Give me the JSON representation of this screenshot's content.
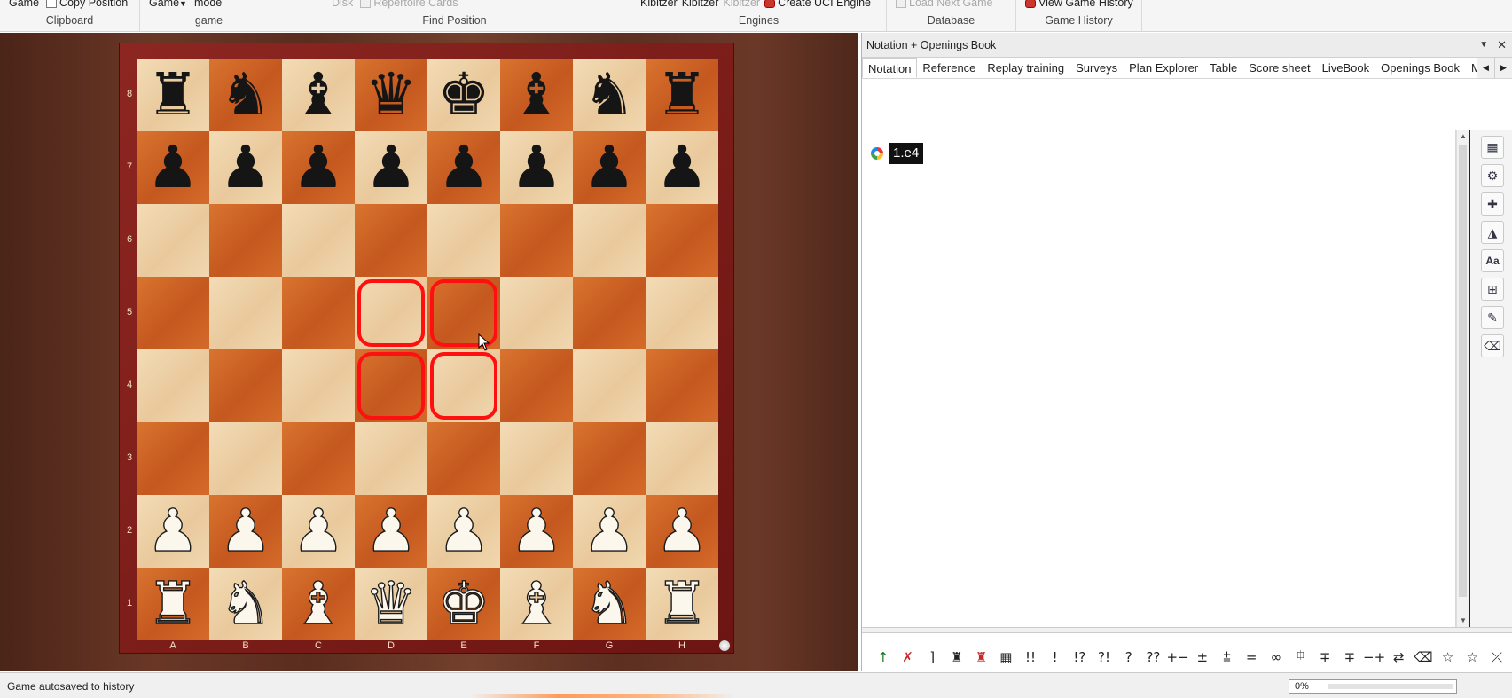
{
  "ribbon": {
    "groups": [
      {
        "id": "clipboard",
        "label": "Clipboard",
        "items": [
          "Game",
          "Copy Position"
        ]
      },
      {
        "id": "game",
        "label": "game",
        "items": [
          "Game",
          "mode"
        ]
      },
      {
        "id": "findpos",
        "label": "Find Position",
        "items": [
          "Disk",
          "Repertoire Cards"
        ]
      },
      {
        "id": "engines",
        "label": "Engines",
        "items": [
          "Kibitzer",
          "Kibitzer",
          "Kibitzer",
          "Create UCI Engine"
        ]
      },
      {
        "id": "database",
        "label": "Database",
        "items": [
          "Load Next Game"
        ]
      },
      {
        "id": "history",
        "label": "Game History",
        "items": [
          "View Game History"
        ]
      }
    ]
  },
  "board": {
    "ranks": [
      "8",
      "7",
      "6",
      "5",
      "4",
      "3",
      "2",
      "1"
    ],
    "files": [
      "A",
      "B",
      "C",
      "D",
      "E",
      "F",
      "G",
      "H"
    ],
    "position": [
      [
        "bR",
        "bN",
        "bB",
        "bQ",
        "bK",
        "bB",
        "bN",
        "bR"
      ],
      [
        "bP",
        "bP",
        "bP",
        "bP",
        "bP",
        "bP",
        "bP",
        "bP"
      ],
      [
        "",
        "",
        "",
        "",
        "",
        "",
        "",
        ""
      ],
      [
        "",
        "",
        "",
        "",
        "",
        "",
        "",
        ""
      ],
      [
        "",
        "",
        "",
        "",
        "",
        "",
        "",
        ""
      ],
      [
        "",
        "",
        "",
        "",
        "",
        "",
        "",
        ""
      ],
      [
        "wP",
        "wP",
        "wP",
        "wP",
        "wP",
        "wP",
        "wP",
        "wP"
      ],
      [
        "wR",
        "wN",
        "wB",
        "wQ",
        "wK",
        "wB",
        "wN",
        "wR"
      ]
    ],
    "highlighted_squares": [
      "d5",
      "e5",
      "d4",
      "e4"
    ],
    "highlight_color": "#ff1010"
  },
  "panel": {
    "title": "Notation + Openings Book",
    "tabs": [
      "Notation",
      "Reference",
      "Replay training",
      "Surveys",
      "Plan Explorer",
      "Table",
      "Score sheet",
      "LiveBook",
      "Openings Book",
      "My"
    ],
    "active_tab": "Notation",
    "moves": [
      "1.e4"
    ],
    "side_tools": [
      "board-icon",
      "engine-icon",
      "add-icon",
      "drop-icon",
      "font-icon",
      "tree-icon",
      "pen-icon",
      "eraser-icon"
    ],
    "annotations": [
      "↑",
      "✗",
      "]",
      "♜",
      "♜",
      "▦",
      "!!",
      "!",
      "!?",
      "?!",
      "?",
      "??",
      "+−",
      "±",
      "⩲",
      "=",
      "∞",
      "⯐",
      "∓",
      "∓",
      "−+",
      "⇄",
      "⌫",
      "☆",
      "☆",
      "⤫"
    ]
  },
  "status": {
    "message": "Game autosaved to history",
    "progress_label": "0%",
    "progress_value": 0
  }
}
